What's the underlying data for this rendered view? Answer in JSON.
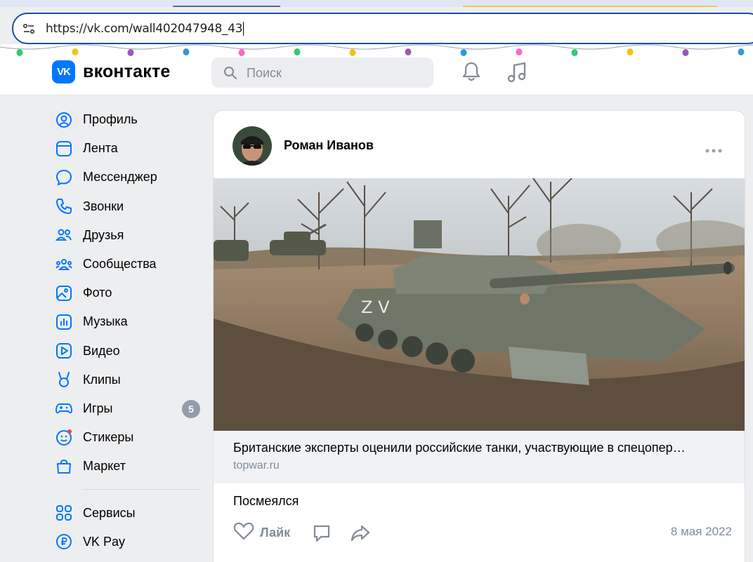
{
  "browser": {
    "url": "https://vk.com/wall402047948_43"
  },
  "header": {
    "logo_text": "VK",
    "wordmark": "вконтакте",
    "search_placeholder": "Поиск"
  },
  "sidebar": {
    "items": [
      {
        "label": "Профиль",
        "icon": "profile-icon"
      },
      {
        "label": "Лента",
        "icon": "feed-icon"
      },
      {
        "label": "Мессенджер",
        "icon": "messenger-icon"
      },
      {
        "label": "Звонки",
        "icon": "phone-icon"
      },
      {
        "label": "Друзья",
        "icon": "friends-icon"
      },
      {
        "label": "Сообщества",
        "icon": "communities-icon"
      },
      {
        "label": "Фото",
        "icon": "photo-icon"
      },
      {
        "label": "Музыка",
        "icon": "music-icon"
      },
      {
        "label": "Видео",
        "icon": "video-icon"
      },
      {
        "label": "Клипы",
        "icon": "clips-icon"
      },
      {
        "label": "Игры",
        "icon": "games-icon",
        "badge": "5"
      },
      {
        "label": "Стикеры",
        "icon": "stickers-icon"
      },
      {
        "label": "Маркет",
        "icon": "market-icon"
      }
    ],
    "secondary": [
      {
        "label": "Сервисы",
        "icon": "services-icon"
      },
      {
        "label": "VK Pay",
        "icon": "vkpay-icon"
      }
    ]
  },
  "post": {
    "author": "Роман Иванов",
    "link_title": "Британские эксперты оценили российские танки, участвующие в спецопер…",
    "link_domain": "topwar.ru",
    "text": "Посмеялся",
    "like_label": "Лайк",
    "date": "8 мая 2022"
  },
  "colors": {
    "accent": "#0077ff",
    "muted": "#818c99",
    "badge": "#939cab"
  }
}
